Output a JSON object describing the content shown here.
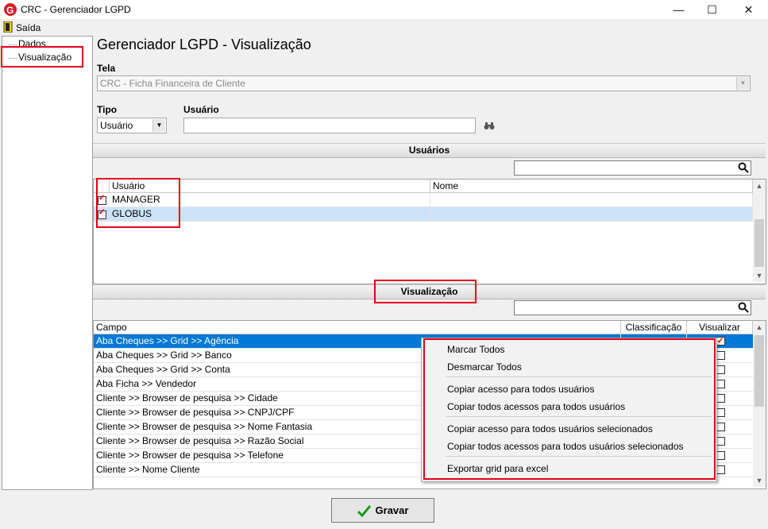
{
  "window": {
    "title": "CRC - Gerenciador LGPD",
    "minimize": "—",
    "maximize": "☐",
    "close": "✕"
  },
  "menu": {
    "exit_label": "Saída"
  },
  "tree": {
    "items": [
      "Dados",
      "Visualização"
    ]
  },
  "page": {
    "heading": "Gerenciador LGPD - Visualização"
  },
  "form": {
    "tela_label": "Tela",
    "tela_value": "CRC - Ficha Financeira de Cliente",
    "tipo_label": "Tipo",
    "tipo_value": "Usuário",
    "usuario_label": "Usuário",
    "usuario_value": ""
  },
  "users_section": {
    "title": "Usuários",
    "search_value": "",
    "columns": [
      "Usuário",
      "Nome"
    ],
    "rows": [
      {
        "usuario": "MANAGER",
        "nome": "",
        "checked": true
      },
      {
        "usuario": "GLOBUS",
        "nome": "",
        "checked": true,
        "selected": true
      }
    ]
  },
  "view_section": {
    "title": "Visualização",
    "search_value": "",
    "columns": [
      "Campo",
      "Classificação",
      "Visualizar"
    ],
    "rows": [
      {
        "campo": "Aba Cheques >> Grid >> Agência",
        "checked": true,
        "selected": true
      },
      {
        "campo": "Aba Cheques >> Grid >> Banco",
        "checked": false
      },
      {
        "campo": "Aba Cheques >> Grid >> Conta",
        "checked": false
      },
      {
        "campo": "Aba Ficha >> Vendedor",
        "checked": false
      },
      {
        "campo": "Cliente >> Browser de pesquisa >> Cidade",
        "checked": false
      },
      {
        "campo": "Cliente >> Browser de pesquisa >> CNPJ/CPF",
        "checked": false
      },
      {
        "campo": "Cliente >> Browser de pesquisa >> Nome Fantasia",
        "checked": false
      },
      {
        "campo": "Cliente >> Browser de pesquisa >> Razão Social",
        "checked": false
      },
      {
        "campo": "Cliente >> Browser de pesquisa >> Telefone",
        "checked": false
      },
      {
        "campo": "Cliente >> Nome Cliente",
        "checked": false
      }
    ]
  },
  "context_menu": {
    "items": [
      "Marcar Todos",
      "Desmarcar Todos",
      "Copiar acesso para todos usuários",
      "Copiar todos acessos para todos usuários",
      "Copiar acesso para todos usuários selecionados",
      "Copiar todos acessos para todos usuários selecionados",
      "Exportar grid para excel"
    ]
  },
  "actions": {
    "save_label": "Gravar"
  },
  "colors": {
    "highlight_red": "#e8001c",
    "selection_blue": "#0078d7",
    "selection_light": "#cce3f7"
  },
  "icons": [
    "app-logo-icon",
    "exit-door-icon",
    "binoculars-icon",
    "search-icon",
    "check-icon"
  ]
}
